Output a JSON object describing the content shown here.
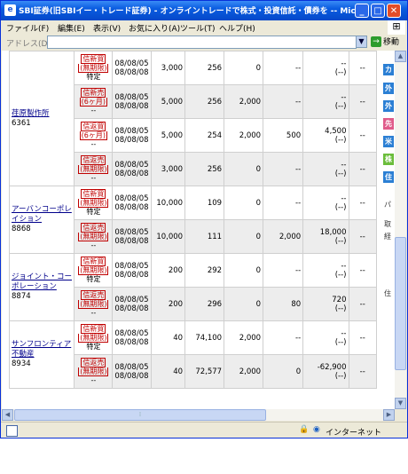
{
  "window": {
    "title": "SBI証券(旧SBIイー・トレード証券) - オンライントレードで株式・投資信託・債券を -- Mic...",
    "app_icon": "ie-icon"
  },
  "menu": [
    "ファイル(F)",
    "編集(E)",
    "表示(V)",
    "お気に入り(A)",
    "ツール(T)",
    "ヘルプ(H)"
  ],
  "address": {
    "label": "アドレス(D)",
    "value": "",
    "go_label": "移動"
  },
  "status": {
    "zone": "インターネット"
  },
  "right_panel": {
    "items": [
      {
        "text": "カ",
        "color": "#2b7fd4"
      },
      {
        "text": "外",
        "color": "#2b7fd4"
      },
      {
        "text": "外",
        "color": "#2b7fd4"
      },
      {
        "text": "先",
        "color": "#e05b8a"
      },
      {
        "text": "米",
        "color": "#2b7fd4"
      },
      {
        "text": "株",
        "color": "#6bbd3b"
      },
      {
        "text": "住",
        "color": "#2b7fd4"
      }
    ],
    "texts": [
      "パ",
      "取",
      "経",
      "住"
    ]
  },
  "table": {
    "rows": [
      {
        "name": "",
        "code": "",
        "badge1": "信新買",
        "badge2": "(無期限)",
        "tax": "特定",
        "date1": "08/08/05",
        "date2": "08/08/08",
        "qty": "3,000",
        "price": "256",
        "fee": "0",
        "x": "--",
        "pnl1": "--",
        "pnl2": "(--)",
        "last": "--",
        "group": "genki",
        "shade": false
      },
      {
        "name": "荏原製作所",
        "code": "6361",
        "badge1": "信新売",
        "badge2": "(6ヶ月)",
        "tax": "--",
        "date1": "08/08/05",
        "date2": "08/08/08",
        "qty": "5,000",
        "price": "256",
        "fee": "2,000",
        "x": "--",
        "pnl1": "--",
        "pnl2": "(--)",
        "last": "--",
        "group": "genki",
        "shade": true
      },
      {
        "name": "",
        "code": "",
        "badge1": "信返買",
        "badge2": "(6ヶ月)",
        "tax": "--",
        "date1": "08/08/05",
        "date2": "08/08/08",
        "qty": "5,000",
        "price": "254",
        "fee": "2,000",
        "x": "500",
        "pnl1": "4,500",
        "pnl2": "(--)",
        "last": "--",
        "group": "genki",
        "shade": false
      },
      {
        "name": "",
        "code": "",
        "badge1": "信返売",
        "badge2": "(無期限)",
        "tax": "--",
        "date1": "08/08/05",
        "date2": "08/08/08",
        "qty": "3,000",
        "price": "256",
        "fee": "0",
        "x": "--",
        "pnl1": "--",
        "pnl2": "(--)",
        "last": "--",
        "group": "genki",
        "shade": true
      },
      {
        "name": "アーバンコーポレイション",
        "code": "8868",
        "badge1": "信新買",
        "badge2": "(無期限)",
        "tax": "特定",
        "date1": "08/08/05",
        "date2": "08/08/08",
        "qty": "10,000",
        "price": "109",
        "fee": "0",
        "x": "--",
        "pnl1": "--",
        "pnl2": "(--)",
        "last": "--",
        "group": "urban",
        "shade": false
      },
      {
        "name": "",
        "code": "",
        "badge1": "信返売",
        "badge2": "(無期限)",
        "tax": "--",
        "date1": "08/08/05",
        "date2": "08/08/08",
        "qty": "10,000",
        "price": "111",
        "fee": "0",
        "x": "2,000",
        "pnl1": "18,000",
        "pnl2": "(--)",
        "last": "--",
        "group": "urban",
        "shade": true
      },
      {
        "name": "ジョイント・コーポレーション",
        "code": "8874",
        "badge1": "信新買",
        "badge2": "(無期限)",
        "tax": "特定",
        "date1": "08/08/05",
        "date2": "08/08/08",
        "qty": "200",
        "price": "292",
        "fee": "0",
        "x": "--",
        "pnl1": "--",
        "pnl2": "(--)",
        "last": "--",
        "group": "joint",
        "shade": false
      },
      {
        "name": "",
        "code": "",
        "badge1": "信返売",
        "badge2": "(無期限)",
        "tax": "--",
        "date1": "08/08/05",
        "date2": "08/08/08",
        "qty": "200",
        "price": "296",
        "fee": "0",
        "x": "80",
        "pnl1": "720",
        "pnl2": "(--)",
        "last": "--",
        "group": "joint",
        "shade": true
      },
      {
        "name": "サンフロンティア不動産",
        "code": "8934",
        "badge1": "信新買",
        "badge2": "(無期限)",
        "tax": "特定",
        "date1": "08/08/05",
        "date2": "08/08/08",
        "qty": "40",
        "price": "74,100",
        "fee": "2,000",
        "x": "--",
        "pnl1": "--",
        "pnl2": "(--)",
        "last": "--",
        "group": "sunfront",
        "shade": false
      },
      {
        "name": "",
        "code": "",
        "badge1": "信返売",
        "badge2": "(無期限)",
        "tax": "--",
        "date1": "08/08/05",
        "date2": "08/08/08",
        "qty": "40",
        "price": "72,577",
        "fee": "2,000",
        "x": "0",
        "pnl1": "-62,900",
        "pnl2": "(--)",
        "last": "--",
        "group": "sunfront",
        "shade": true
      }
    ]
  }
}
